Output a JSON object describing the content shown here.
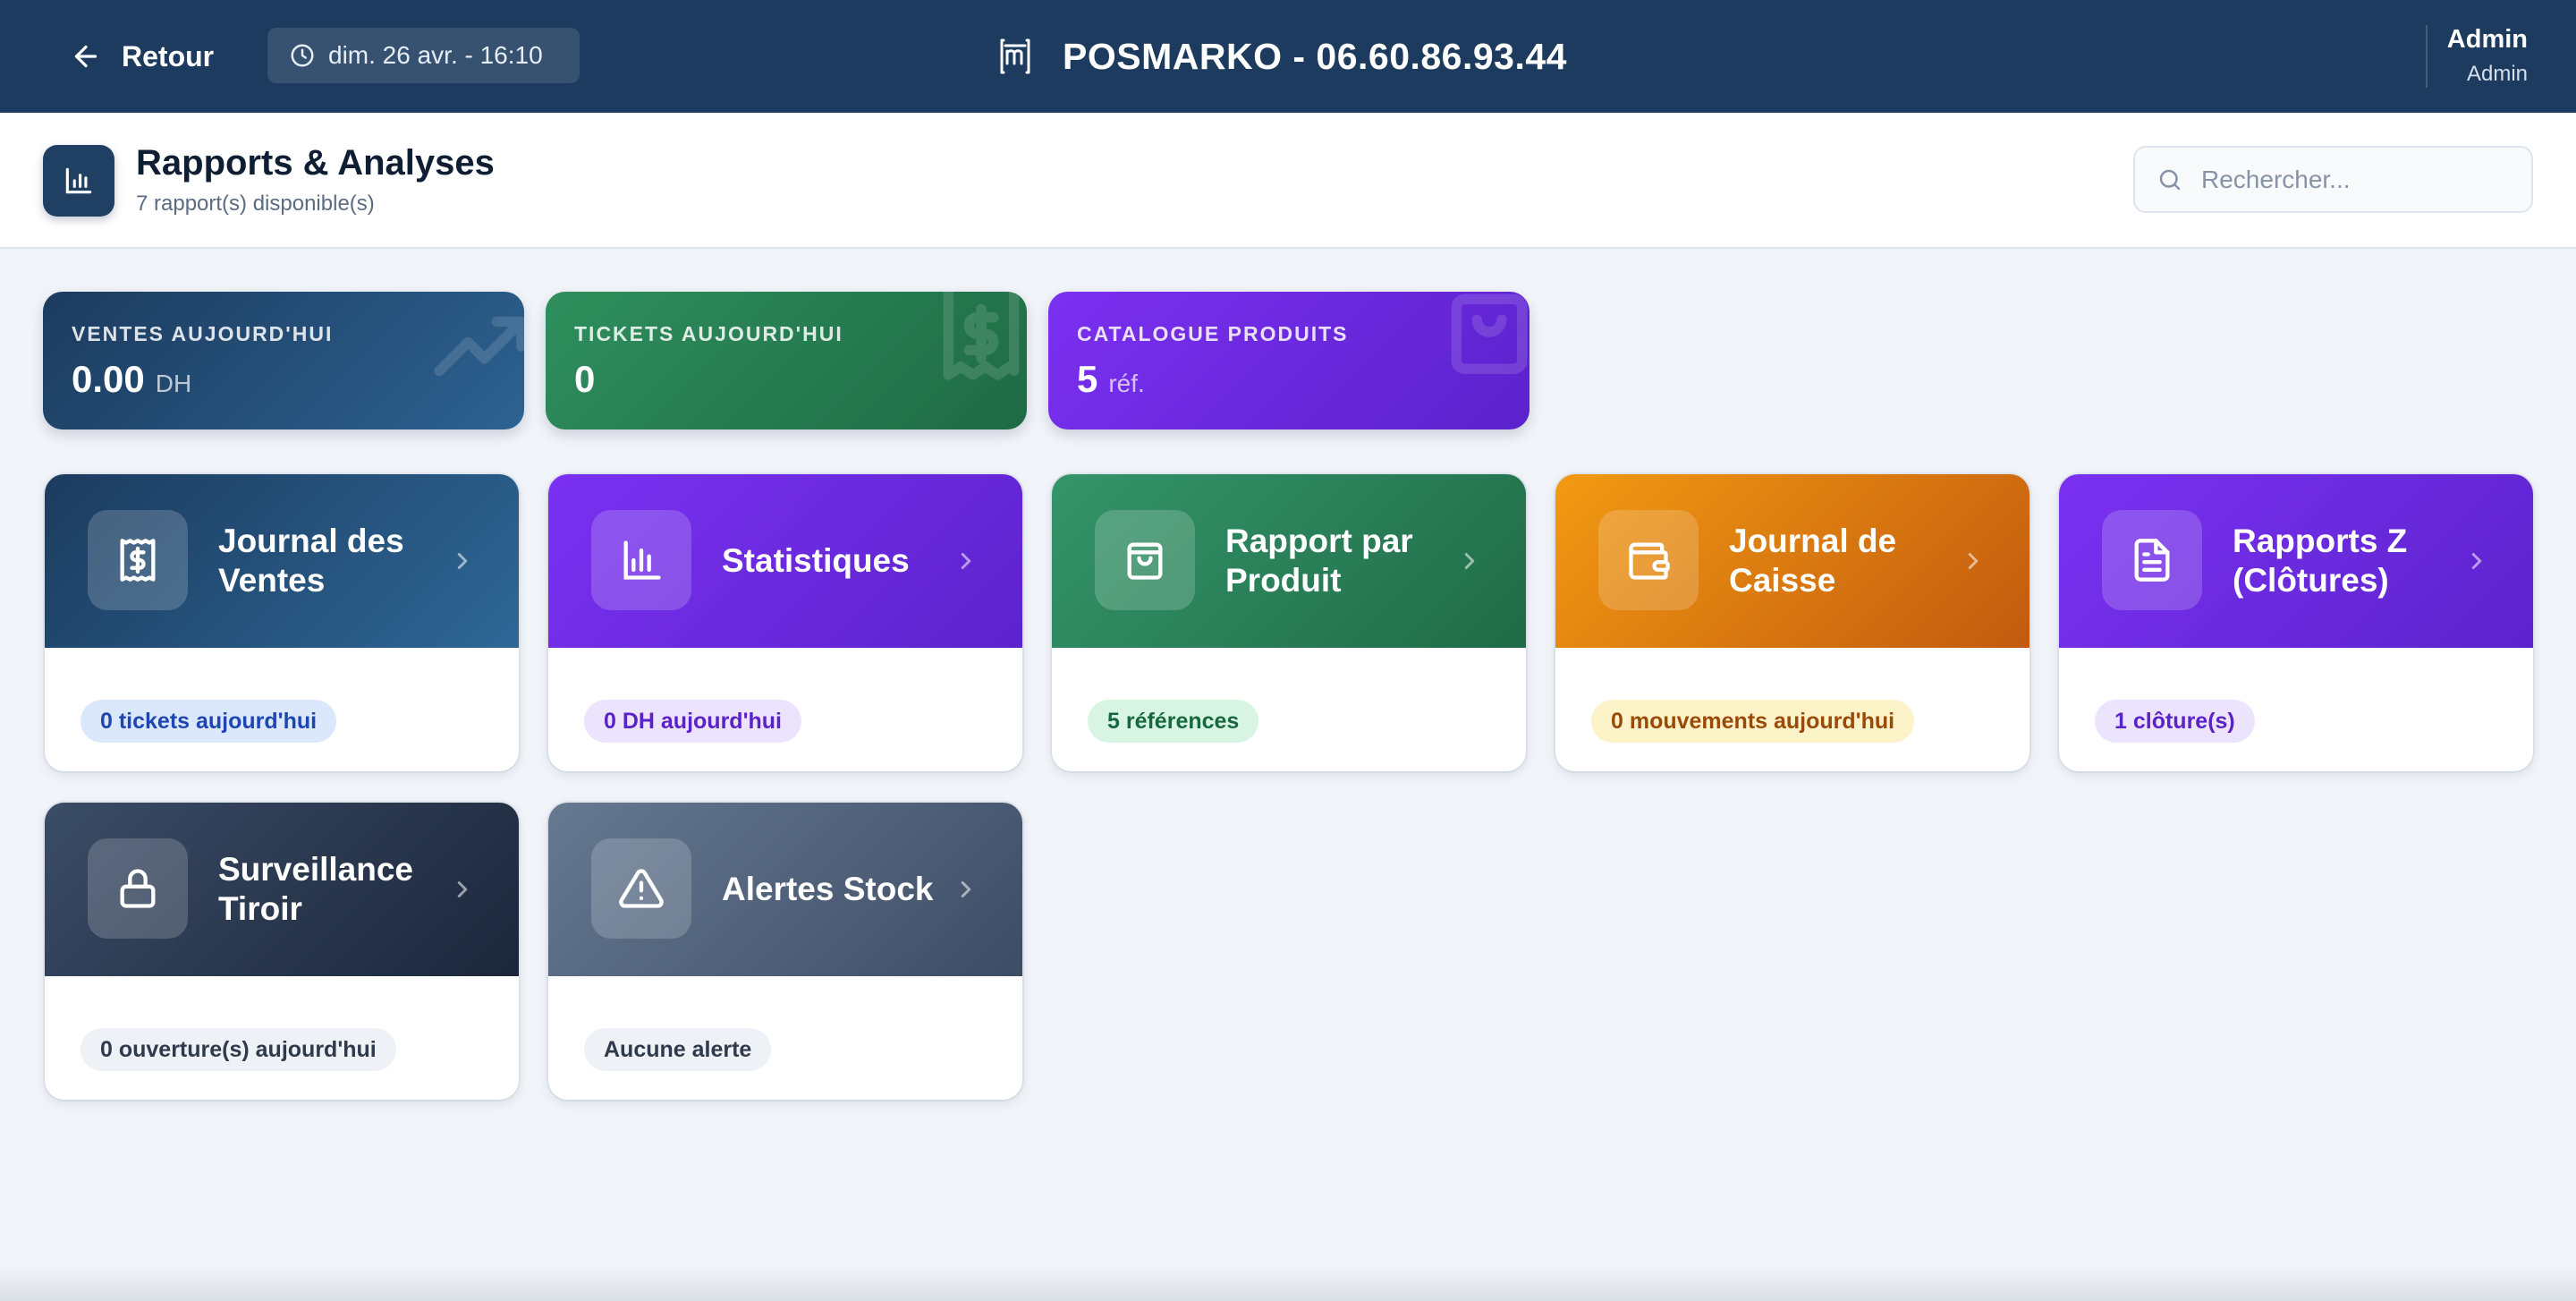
{
  "topbar": {
    "back_label": "Retour",
    "datetime": "dim. 26 avr. - 16:10",
    "brand": "POSMARKO - 06.60.86.93.44",
    "user_name": "Admin",
    "user_role": "Admin"
  },
  "header": {
    "title": "Rapports & Analyses",
    "subtitle": "7 rapport(s) disponible(s)",
    "search_placeholder": "Rechercher..."
  },
  "stats": [
    {
      "label": "VENTES AUJOURD'HUI",
      "value": "0.00",
      "unit": "DH",
      "icon": "trending-up-icon"
    },
    {
      "label": "TICKETS AUJOURD'HUI",
      "value": "0",
      "unit": "",
      "icon": "receipt-icon"
    },
    {
      "label": "CATALOGUE PRODUITS",
      "value": "5",
      "unit": "réf.",
      "icon": "shopping-bag-icon"
    }
  ],
  "reports": [
    {
      "title": "Journal des Ventes",
      "badge": "0 tickets aujourd'hui",
      "icon": "receipt-icon"
    },
    {
      "title": "Statistiques",
      "badge": "0 DH aujourd'hui",
      "icon": "bar-chart-icon"
    },
    {
      "title": "Rapport par Produit",
      "badge": "5 références",
      "icon": "shopping-bag-icon"
    },
    {
      "title": "Journal de Caisse",
      "badge": "0 mouvements aujourd'hui",
      "icon": "wallet-icon"
    },
    {
      "title": "Rapports Z (Clôtures)",
      "badge": "1 clôture(s)",
      "icon": "file-text-icon"
    },
    {
      "title": "Surveillance Tiroir",
      "badge": "0 ouverture(s) aujourd'hui",
      "icon": "lock-icon"
    },
    {
      "title": "Alertes Stock",
      "badge": "Aucune alerte",
      "icon": "alert-triangle-icon"
    }
  ],
  "colors": {
    "topbar": "#1c3b5e",
    "background": "#f1f4f9",
    "purple": "#7a31f2",
    "green": "#35956a",
    "orange": "#f29a12"
  }
}
